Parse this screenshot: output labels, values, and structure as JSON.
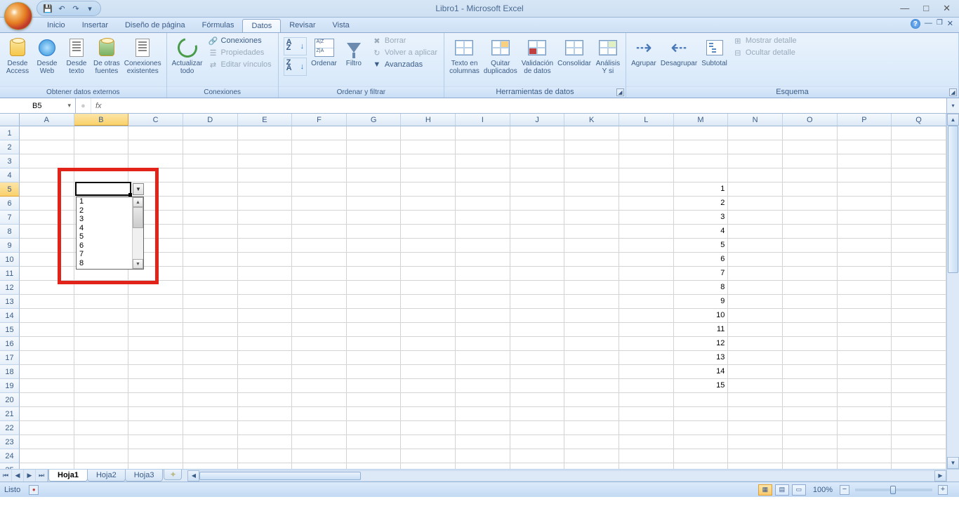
{
  "title": "Libro1 - Microsoft Excel",
  "qat": {
    "save": "💾",
    "undo": "↶",
    "redo": "↷",
    "more": "▾"
  },
  "tabs": [
    "Inicio",
    "Insertar",
    "Diseño de página",
    "Fórmulas",
    "Datos",
    "Revisar",
    "Vista"
  ],
  "active_tab": 4,
  "ribbon": {
    "g1": {
      "label": "Obtener datos externos",
      "access": "Desde\nAccess",
      "web": "Desde\nWeb",
      "text": "Desde\ntexto",
      "other": "De otras\nfuentes",
      "existing": "Conexiones\nexistentes"
    },
    "g2": {
      "label": "Conexiones",
      "refresh": "Actualizar\ntodo",
      "conn": "Conexiones",
      "prop": "Propiedades",
      "edit": "Editar vínculos"
    },
    "g3": {
      "label": "Ordenar y filtrar",
      "sort": "Ordenar",
      "filter": "Filtro",
      "clear": "Borrar",
      "reapply": "Volver a aplicar",
      "adv": "Avanzadas"
    },
    "g4": {
      "label": "Herramientas de datos",
      "ttc": "Texto en\ncolumnas",
      "dup": "Quitar\nduplicados",
      "val": "Validación\nde datos",
      "cons": "Consolidar",
      "what": "Análisis\nY si"
    },
    "g5": {
      "label": "Esquema",
      "group": "Agrupar",
      "ungroup": "Desagrupar",
      "sub": "Subtotal",
      "show": "Mostrar detalle",
      "hide": "Ocultar detalle"
    }
  },
  "namebox": "B5",
  "columns": [
    "A",
    "B",
    "C",
    "D",
    "E",
    "F",
    "G",
    "H",
    "I",
    "J",
    "K",
    "L",
    "M",
    "N",
    "O",
    "P",
    "Q"
  ],
  "sel_col": 1,
  "rows": 25,
  "sel_row": 4,
  "m_values": {
    "4": "1",
    "5": "2",
    "6": "3",
    "7": "4",
    "8": "5",
    "9": "6",
    "10": "7",
    "11": "8",
    "12": "9",
    "13": "10",
    "14": "11",
    "15": "12",
    "16": "13",
    "17": "14",
    "18": "15"
  },
  "m_col": 12,
  "dropdown": {
    "items": [
      "1",
      "2",
      "3",
      "4",
      "5",
      "6",
      "7",
      "8"
    ]
  },
  "sheets": [
    "Hoja1",
    "Hoja2",
    "Hoja3"
  ],
  "active_sheet": 0,
  "status": {
    "ready": "Listo",
    "zoom": "100%"
  }
}
